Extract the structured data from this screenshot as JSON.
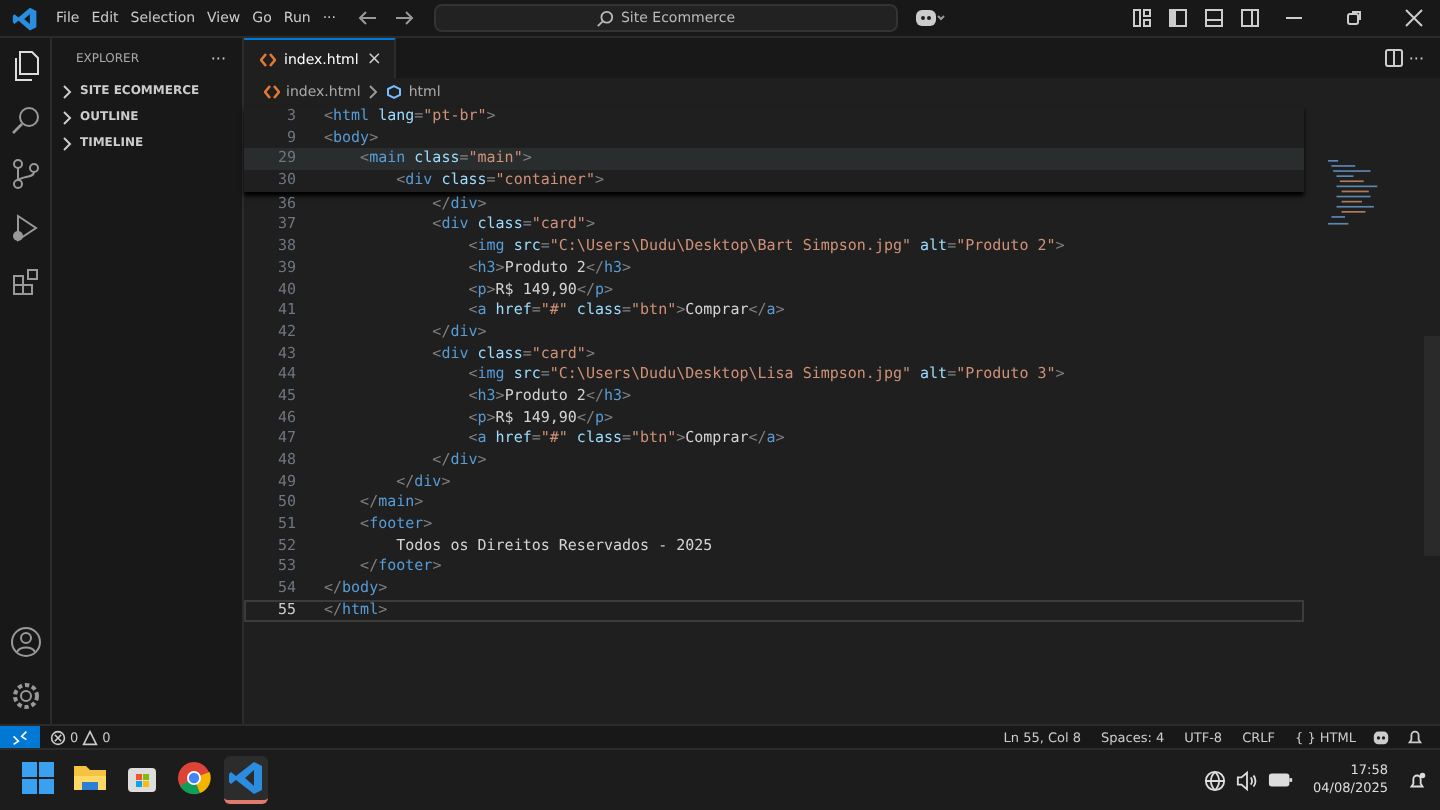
{
  "title_bar": {
    "menu": [
      "File",
      "Edit",
      "Selection",
      "View",
      "Go",
      "Run",
      "···"
    ],
    "search": {
      "value": "Site Ecommerce"
    }
  },
  "sidebar": {
    "title": "EXPLORER",
    "more": "···",
    "sections": [
      {
        "label": "SITE ECOMMERCE",
        "expanded": false
      },
      {
        "label": "OUTLINE",
        "expanded": false
      },
      {
        "label": "TIMELINE",
        "expanded": false
      }
    ]
  },
  "tabs": [
    {
      "label": "index.html",
      "selected": true,
      "close": "×"
    }
  ],
  "editor_actions": {
    "more": "···"
  },
  "breadcrumbs": [
    "index.html",
    "html"
  ],
  "sticky_lines": [
    {
      "number": "3",
      "highlighted": false,
      "tokens": [
        {
          "kind": "punct",
          "text": "<"
        },
        {
          "kind": "tag",
          "text": "html"
        },
        {
          "kind": "attr",
          "text": " lang"
        },
        {
          "kind": "punct",
          "text": "="
        },
        {
          "kind": "str",
          "text": "\"pt-br\""
        },
        {
          "kind": "punct",
          "text": ">"
        }
      ]
    },
    {
      "number": "9",
      "highlighted": false,
      "tokens": [
        {
          "kind": "punct",
          "text": "<"
        },
        {
          "kind": "tag",
          "text": "body"
        },
        {
          "kind": "punct",
          "text": ">"
        }
      ]
    },
    {
      "number": "29",
      "highlighted": true,
      "tokens": [
        {
          "kind": "punct",
          "text": "    <"
        },
        {
          "kind": "tag",
          "text": "main"
        },
        {
          "kind": "attr",
          "text": " class"
        },
        {
          "kind": "punct",
          "text": "="
        },
        {
          "kind": "str",
          "text": "\"main\""
        },
        {
          "kind": "punct",
          "text": ">"
        }
      ]
    },
    {
      "number": "30",
      "highlighted": false,
      "tokens": [
        {
          "kind": "punct",
          "text": "        <"
        },
        {
          "kind": "tag",
          "text": "div"
        },
        {
          "kind": "attr",
          "text": " class"
        },
        {
          "kind": "punct",
          "text": "="
        },
        {
          "kind": "str",
          "text": "\"container\""
        },
        {
          "kind": "punct",
          "text": ">"
        }
      ]
    }
  ],
  "lines": [
    {
      "number": "36",
      "current": false,
      "tokens": [
        {
          "kind": "punct",
          "text": "            </"
        },
        {
          "kind": "tag",
          "text": "div"
        },
        {
          "kind": "punct",
          "text": ">"
        }
      ]
    },
    {
      "number": "37",
      "current": false,
      "tokens": [
        {
          "kind": "punct",
          "text": "            <"
        },
        {
          "kind": "tag",
          "text": "div"
        },
        {
          "kind": "attr",
          "text": " class"
        },
        {
          "kind": "punct",
          "text": "="
        },
        {
          "kind": "str",
          "text": "\"card\""
        },
        {
          "kind": "punct",
          "text": ">"
        }
      ]
    },
    {
      "number": "38",
      "current": false,
      "tokens": [
        {
          "kind": "punct",
          "text": "                <"
        },
        {
          "kind": "tag",
          "text": "img"
        },
        {
          "kind": "attr",
          "text": " src"
        },
        {
          "kind": "punct",
          "text": "="
        },
        {
          "kind": "str",
          "text": "\"C:\\Users\\Dudu\\Desktop\\Bart Simpson.jpg\""
        },
        {
          "kind": "attr",
          "text": " alt"
        },
        {
          "kind": "punct",
          "text": "="
        },
        {
          "kind": "str",
          "text": "\"Produto 2\""
        },
        {
          "kind": "punct",
          "text": ">"
        }
      ]
    },
    {
      "number": "39",
      "current": false,
      "tokens": [
        {
          "kind": "punct",
          "text": "                <"
        },
        {
          "kind": "tag",
          "text": "h3"
        },
        {
          "kind": "punct",
          "text": ">"
        },
        {
          "kind": "text",
          "text": "Produto 2"
        },
        {
          "kind": "punct",
          "text": "</"
        },
        {
          "kind": "tag",
          "text": "h3"
        },
        {
          "kind": "punct",
          "text": ">"
        }
      ]
    },
    {
      "number": "40",
      "current": false,
      "tokens": [
        {
          "kind": "punct",
          "text": "                <"
        },
        {
          "kind": "tag",
          "text": "p"
        },
        {
          "kind": "punct",
          "text": ">"
        },
        {
          "kind": "text",
          "text": "R$ 149,90"
        },
        {
          "kind": "punct",
          "text": "</"
        },
        {
          "kind": "tag",
          "text": "p"
        },
        {
          "kind": "punct",
          "text": ">"
        }
      ]
    },
    {
      "number": "41",
      "current": false,
      "tokens": [
        {
          "kind": "punct",
          "text": "                <"
        },
        {
          "kind": "tag",
          "text": "a"
        },
        {
          "kind": "attr",
          "text": " href"
        },
        {
          "kind": "punct",
          "text": "="
        },
        {
          "kind": "str",
          "text": "\"#\""
        },
        {
          "kind": "attr",
          "text": " class"
        },
        {
          "kind": "punct",
          "text": "="
        },
        {
          "kind": "str",
          "text": "\"btn\""
        },
        {
          "kind": "punct",
          "text": ">"
        },
        {
          "kind": "text",
          "text": "Comprar"
        },
        {
          "kind": "punct",
          "text": "</"
        },
        {
          "kind": "tag",
          "text": "a"
        },
        {
          "kind": "punct",
          "text": ">"
        }
      ]
    },
    {
      "number": "42",
      "current": false,
      "tokens": [
        {
          "kind": "punct",
          "text": "            </"
        },
        {
          "kind": "tag",
          "text": "div"
        },
        {
          "kind": "punct",
          "text": ">"
        }
      ]
    },
    {
      "number": "43",
      "current": false,
      "tokens": [
        {
          "kind": "punct",
          "text": "            <"
        },
        {
          "kind": "tag",
          "text": "div"
        },
        {
          "kind": "attr",
          "text": " class"
        },
        {
          "kind": "punct",
          "text": "="
        },
        {
          "kind": "str",
          "text": "\"card\""
        },
        {
          "kind": "punct",
          "text": ">"
        }
      ]
    },
    {
      "number": "44",
      "current": false,
      "tokens": [
        {
          "kind": "punct",
          "text": "                <"
        },
        {
          "kind": "tag",
          "text": "img"
        },
        {
          "kind": "attr",
          "text": " src"
        },
        {
          "kind": "punct",
          "text": "="
        },
        {
          "kind": "str",
          "text": "\"C:\\Users\\Dudu\\Desktop\\Lisa Simpson.jpg\""
        },
        {
          "kind": "attr",
          "text": " alt"
        },
        {
          "kind": "punct",
          "text": "="
        },
        {
          "kind": "str",
          "text": "\"Produto 3\""
        },
        {
          "kind": "punct",
          "text": ">"
        }
      ]
    },
    {
      "number": "45",
      "current": false,
      "tokens": [
        {
          "kind": "punct",
          "text": "                <"
        },
        {
          "kind": "tag",
          "text": "h3"
        },
        {
          "kind": "punct",
          "text": ">"
        },
        {
          "kind": "text",
          "text": "Produto 2"
        },
        {
          "kind": "punct",
          "text": "</"
        },
        {
          "kind": "tag",
          "text": "h3"
        },
        {
          "kind": "punct",
          "text": ">"
        }
      ]
    },
    {
      "number": "46",
      "current": false,
      "tokens": [
        {
          "kind": "punct",
          "text": "                <"
        },
        {
          "kind": "tag",
          "text": "p"
        },
        {
          "kind": "punct",
          "text": ">"
        },
        {
          "kind": "text",
          "text": "R$ 149,90"
        },
        {
          "kind": "punct",
          "text": "</"
        },
        {
          "kind": "tag",
          "text": "p"
        },
        {
          "kind": "punct",
          "text": ">"
        }
      ]
    },
    {
      "number": "47",
      "current": false,
      "tokens": [
        {
          "kind": "punct",
          "text": "                <"
        },
        {
          "kind": "tag",
          "text": "a"
        },
        {
          "kind": "attr",
          "text": " href"
        },
        {
          "kind": "punct",
          "text": "="
        },
        {
          "kind": "str",
          "text": "\"#\""
        },
        {
          "kind": "attr",
          "text": " class"
        },
        {
          "kind": "punct",
          "text": "="
        },
        {
          "kind": "str",
          "text": "\"btn\""
        },
        {
          "kind": "punct",
          "text": ">"
        },
        {
          "kind": "text",
          "text": "Comprar"
        },
        {
          "kind": "punct",
          "text": "</"
        },
        {
          "kind": "tag",
          "text": "a"
        },
        {
          "kind": "punct",
          "text": ">"
        }
      ]
    },
    {
      "number": "48",
      "current": false,
      "tokens": [
        {
          "kind": "punct",
          "text": "            </"
        },
        {
          "kind": "tag",
          "text": "div"
        },
        {
          "kind": "punct",
          "text": ">"
        }
      ]
    },
    {
      "number": "49",
      "current": false,
      "tokens": [
        {
          "kind": "punct",
          "text": "        </"
        },
        {
          "kind": "tag",
          "text": "div"
        },
        {
          "kind": "punct",
          "text": ">"
        }
      ]
    },
    {
      "number": "50",
      "current": false,
      "tokens": [
        {
          "kind": "punct",
          "text": "    </"
        },
        {
          "kind": "tag",
          "text": "main"
        },
        {
          "kind": "punct",
          "text": ">"
        }
      ]
    },
    {
      "number": "51",
      "current": false,
      "tokens": [
        {
          "kind": "punct",
          "text": "    <"
        },
        {
          "kind": "tag",
          "text": "footer"
        },
        {
          "kind": "punct",
          "text": ">"
        }
      ]
    },
    {
      "number": "52",
      "current": false,
      "tokens": [
        {
          "kind": "text",
          "text": "        Todos os Direitos Reservados - 2025"
        }
      ]
    },
    {
      "number": "53",
      "current": false,
      "tokens": [
        {
          "kind": "punct",
          "text": "    </"
        },
        {
          "kind": "tag",
          "text": "footer"
        },
        {
          "kind": "punct",
          "text": ">"
        }
      ]
    },
    {
      "number": "54",
      "current": false,
      "tokens": [
        {
          "kind": "punct",
          "text": "</"
        },
        {
          "kind": "tag",
          "text": "body"
        },
        {
          "kind": "punct",
          "text": ">"
        }
      ]
    },
    {
      "number": "55",
      "current": true,
      "tokens": [
        {
          "kind": "punct",
          "text": "</"
        },
        {
          "kind": "tag",
          "text": "html"
        },
        {
          "kind": "punct",
          "text": ">"
        }
      ]
    }
  ],
  "status_bar": {
    "errors": "0",
    "warnings": "0",
    "right": [
      "Ln 55, Col 8",
      "Spaces: 4",
      "UTF-8",
      "CRLF",
      "{ } HTML"
    ]
  },
  "taskbar": {
    "apps": [
      {
        "kind": "start",
        "selected": false
      },
      {
        "kind": "folder",
        "selected": false
      },
      {
        "kind": "store",
        "selected": false
      },
      {
        "kind": "browser",
        "selected": false
      },
      {
        "kind": "editor",
        "selected": true
      }
    ],
    "time": "17:58",
    "date": "04/08/2025"
  }
}
